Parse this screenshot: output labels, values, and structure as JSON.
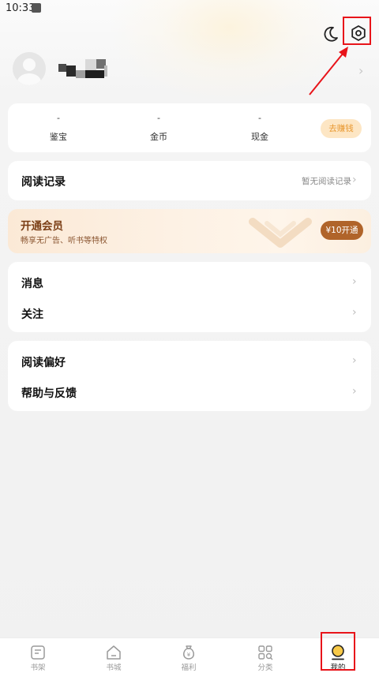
{
  "status_bar": {
    "time": "10:33"
  },
  "header": {
    "moon_icon": "moon-icon",
    "settings_icon": "gear-icon"
  },
  "colors": {
    "accent_orange": "#e8972e",
    "vip_brown": "#b0642a",
    "annotation_red": "#e8141a"
  },
  "assets": [
    {
      "value": "-",
      "label": "鉴宝"
    },
    {
      "value": "-",
      "label": "金币"
    },
    {
      "value": "-",
      "label": "现金"
    }
  ],
  "earn_button": "去赚钱",
  "history": {
    "title": "阅读记录",
    "subtitle": "暂无阅读记录"
  },
  "vip": {
    "title": "开通会员",
    "subtitle": "畅享无广告、听书等特权",
    "button": "¥10开通"
  },
  "menu_group_1": [
    {
      "label": "消息"
    },
    {
      "label": "关注"
    }
  ],
  "menu_group_2": [
    {
      "label": "阅读偏好"
    },
    {
      "label": "帮助与反馈"
    }
  ],
  "tabs": [
    {
      "label": "书架",
      "icon": "bookshelf-icon"
    },
    {
      "label": "书城",
      "icon": "home-icon"
    },
    {
      "label": "福利",
      "icon": "money-bag-icon"
    },
    {
      "label": "分类",
      "icon": "category-grid-icon"
    },
    {
      "label": "我的",
      "icon": "profile-icon",
      "active": true
    }
  ]
}
